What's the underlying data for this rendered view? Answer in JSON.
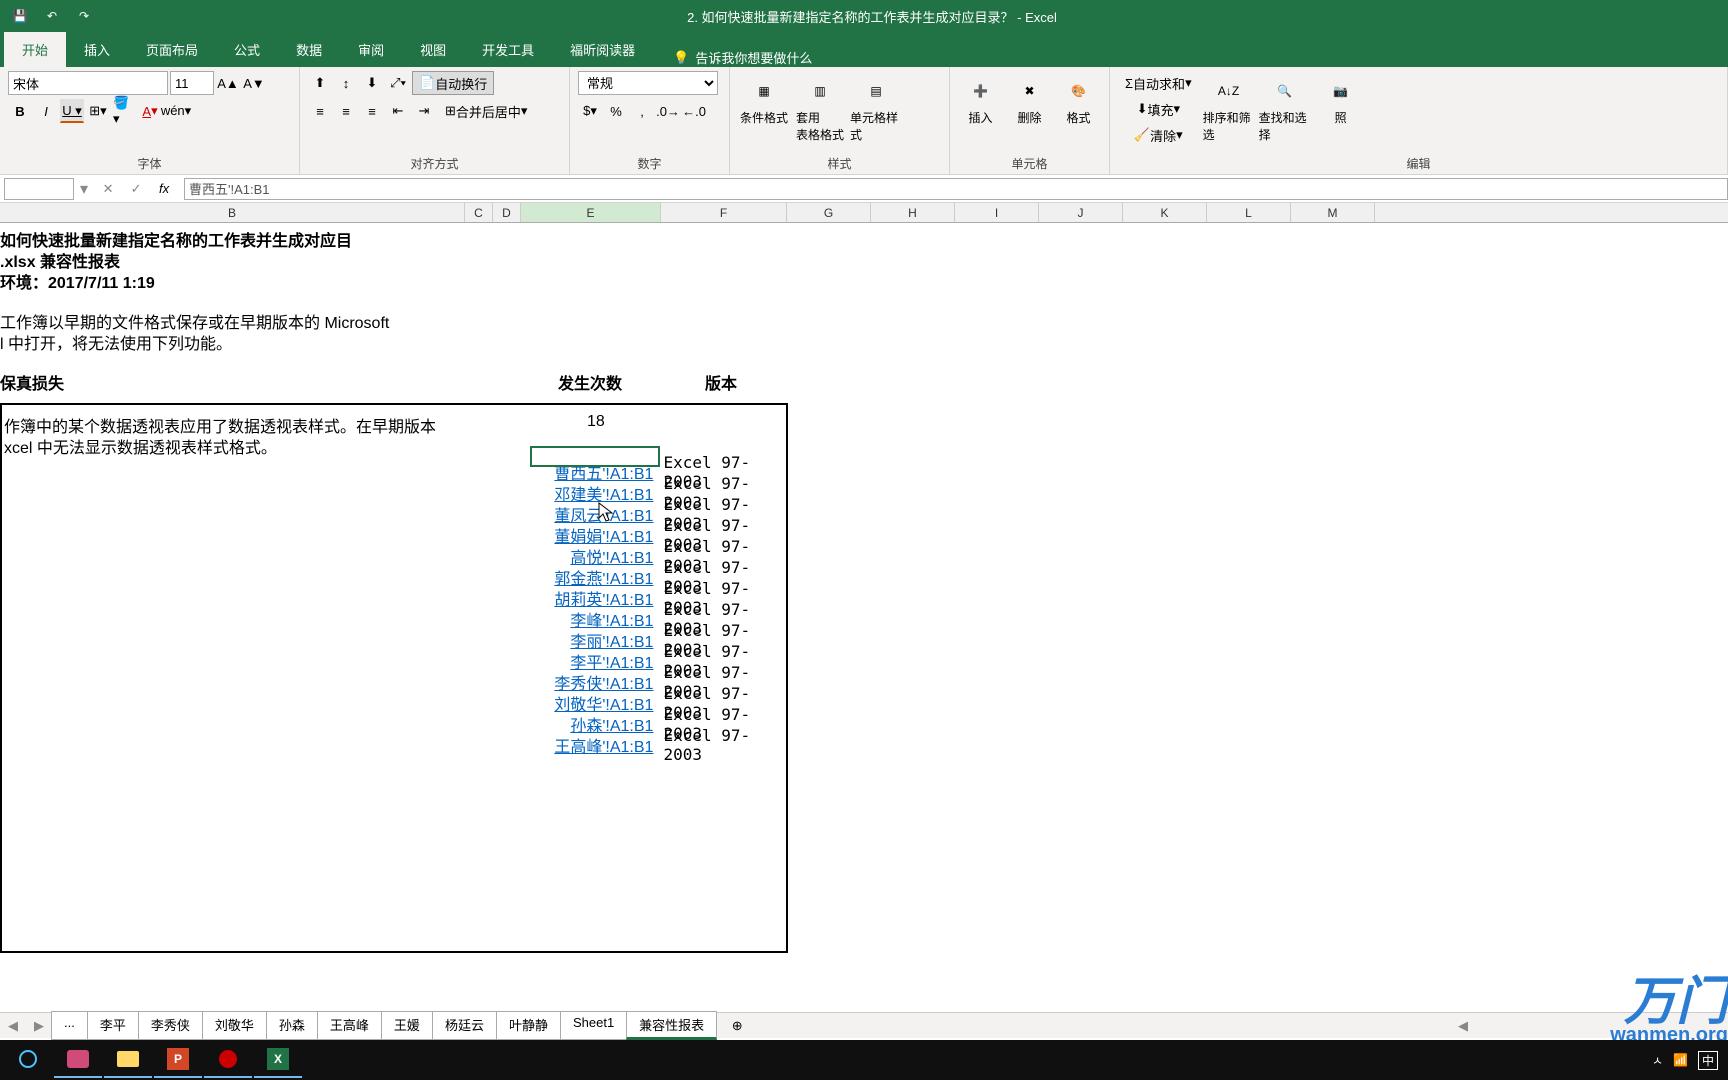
{
  "title": "2.  如何快速批量新建指定名称的工作表并生成对应目录？  -  Excel",
  "tabs": [
    "开始",
    "插入",
    "页面布局",
    "公式",
    "数据",
    "审阅",
    "视图",
    "开发工具",
    "福昕阅读器"
  ],
  "tell_me": "告诉我你想要做什么",
  "font": {
    "name": "宋体",
    "size": "11"
  },
  "groups": {
    "font": "字体",
    "align": "对齐方式",
    "number": "数字",
    "styles": "样式",
    "cells": "单元格",
    "editing": "编辑"
  },
  "align_btns": {
    "wrap": "自动换行",
    "merge": "合并后居中"
  },
  "number_format": "常规",
  "style_btns": {
    "cond": "条件格式",
    "table": "套用\n表格格式",
    "cell": "单元格样式"
  },
  "cell_btns": {
    "insert": "插入",
    "delete": "删除",
    "format": "格式"
  },
  "edit_btns": {
    "sum": "自动求和",
    "fill": "填充",
    "clear": "清除",
    "sort": "排序和筛选",
    "find": "查找和选择",
    "sel": "照"
  },
  "formula_bar": "曹西五'!A1:B1",
  "headers": [
    "B",
    "C",
    "D",
    "E",
    "F",
    "G",
    "H",
    "I",
    "J",
    "K",
    "L",
    "M"
  ],
  "doc": {
    "l1": "如何快速批量新建指定名称的工作表并生成对应目",
    "l2": ".xlsx 兼容性报表",
    "l3": "环境：2017/7/11 1:19",
    "l4": "工作簿以早期的文件格式保存或在早期版本的 Microsoft",
    "l5": "l 中打开，将无法使用下列功能。",
    "l6": "保真损失",
    "h_count": "发生次数",
    "h_ver": "版本",
    "l7": "作簿中的某个数据透视表应用了数据透视表样式。在早期版本",
    "l8": "xcel 中无法显示数据透视表样式格式。",
    "count": "18"
  },
  "links": [
    {
      "t": "曹西五'!A1:B1",
      "v": "Excel 97-2003"
    },
    {
      "t": "邓建美'!A1:B1",
      "v": "Excel 97-2003"
    },
    {
      "t": "董凤云'!A1:B1",
      "v": "Excel 97-2003"
    },
    {
      "t": "董娟娟'!A1:B1",
      "v": "Excel 97-2003"
    },
    {
      "t": "高悦'!A1:B1",
      "v": "Excel 97-2003"
    },
    {
      "t": "郭金燕'!A1:B1",
      "v": "Excel 97-2003"
    },
    {
      "t": "胡莉英'!A1:B1",
      "v": "Excel 97-2003"
    },
    {
      "t": "李峰'!A1:B1",
      "v": "Excel 97-2003"
    },
    {
      "t": "李丽'!A1:B1",
      "v": "Excel 97-2003"
    },
    {
      "t": "李平'!A1:B1",
      "v": "Excel 97-2003"
    },
    {
      "t": "李秀侠'!A1:B1",
      "v": "Excel 97-2003"
    },
    {
      "t": "刘敬华'!A1:B1",
      "v": "Excel 97-2003"
    },
    {
      "t": "孙森'!A1:B1",
      "v": "Excel 97-2003"
    },
    {
      "t": "王高峰'!A1:B1",
      "v": "Excel 97-2003"
    }
  ],
  "sheet_tabs": [
    "...",
    "李平",
    "李秀侠",
    "刘敬华",
    "孙森",
    "王高峰",
    "王媛",
    "杨廷云",
    "叶静静",
    "Sheet1",
    "兼容性报表"
  ],
  "watermark": {
    "main": "万门",
    "sub": "wanmen.org"
  },
  "tray": {
    "ime": "中"
  }
}
